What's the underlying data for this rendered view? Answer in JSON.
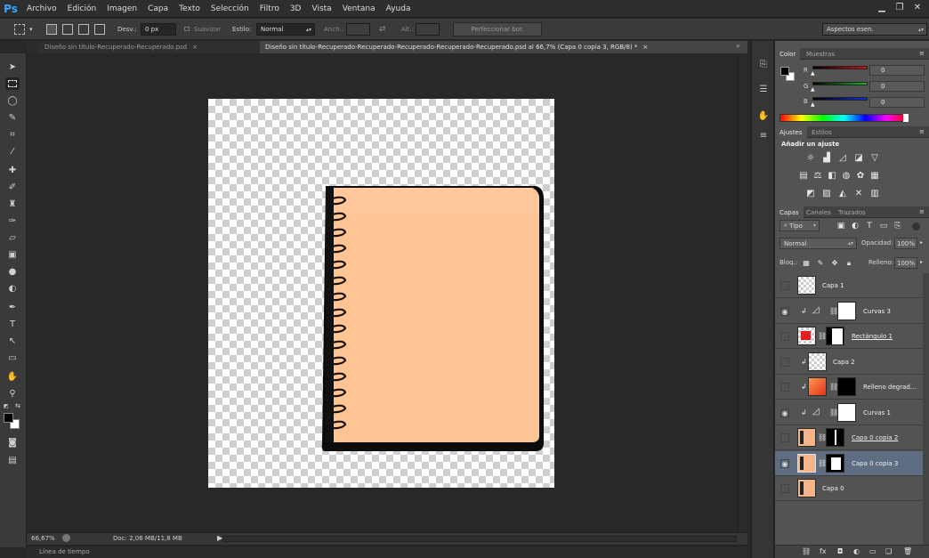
{
  "app": {
    "logo": "Ps",
    "menu": [
      "Archivo",
      "Edición",
      "Imagen",
      "Capa",
      "Texto",
      "Selección",
      "Filtro",
      "3D",
      "Vista",
      "Ventana",
      "Ayuda"
    ],
    "window_controls": [
      "minimize-icon",
      "restore-icon",
      "close-icon"
    ]
  },
  "options": {
    "feather_label": "Desv.:",
    "feather_value": "0 px",
    "antialias_label": "Suavizar",
    "style_label": "Estilo:",
    "style_value": "Normal",
    "width_label": "Anch.:",
    "height_label": "Alt.:",
    "refine_button": "Perfeccionar bor.",
    "workspace_value": "Aspectos esen."
  },
  "tabs": [
    {
      "label": "Diseño sin título-Recuperado-Recuperado.psd",
      "close": "×",
      "active": false
    },
    {
      "label": "Diseño sin título-Recuperado-Recuperado-Recuperado-Recuperado-Recuperado.psd al 66,7% (Capa 0 copia 3, RGB/8) *",
      "close": "×",
      "active": true
    }
  ],
  "status": {
    "zoom": "66,67%",
    "doc": "Doc: 2,06 MB/11,8 MB",
    "timeline": "Línea de tiempo"
  },
  "color_panel": {
    "tabs": [
      "Color",
      "Muestras"
    ],
    "channels": [
      {
        "label": "R",
        "value": "0",
        "color": "#e01010"
      },
      {
        "label": "G",
        "value": "0",
        "color": "#10c020"
      },
      {
        "label": "B",
        "value": "0",
        "color": "#1030e0"
      }
    ]
  },
  "adjustments_panel": {
    "tabs": [
      "Ajustes",
      "Estilos"
    ],
    "heading": "Añadir un ajuste"
  },
  "layers_panel": {
    "tabs": [
      "Capas",
      "Canales",
      "Trazados"
    ],
    "filter_value": "Tipo",
    "blend_mode": "Normal",
    "opacity_label": "Opacidad:",
    "opacity_value": "100%",
    "lock_label": "Bloq.:",
    "fill_label": "Relleno:",
    "fill_value": "100%",
    "layers": [
      {
        "name": "Capa 1",
        "visible": false,
        "type": "pixel"
      },
      {
        "name": "Curvas 3",
        "visible": true,
        "type": "adjustment"
      },
      {
        "name": "Rectángulo 1",
        "visible": false,
        "type": "shape"
      },
      {
        "name": "Capa 2",
        "visible": false,
        "type": "clipped"
      },
      {
        "name": "Relleno degrad...",
        "visible": false,
        "type": "gradient"
      },
      {
        "name": "Curvas 1",
        "visible": true,
        "type": "adjustment"
      },
      {
        "name": "Capa 0 copia 2",
        "visible": false,
        "type": "masked"
      },
      {
        "name": "Capa 0 copia 3",
        "visible": true,
        "type": "masked",
        "selected": true
      },
      {
        "name": "Capa 0",
        "visible": false,
        "type": "photo"
      }
    ]
  },
  "colors": {
    "accent_selected_layer": "#5f6d82",
    "notebook_page": "#ffc494",
    "ps_blue": "#31a8ff"
  }
}
